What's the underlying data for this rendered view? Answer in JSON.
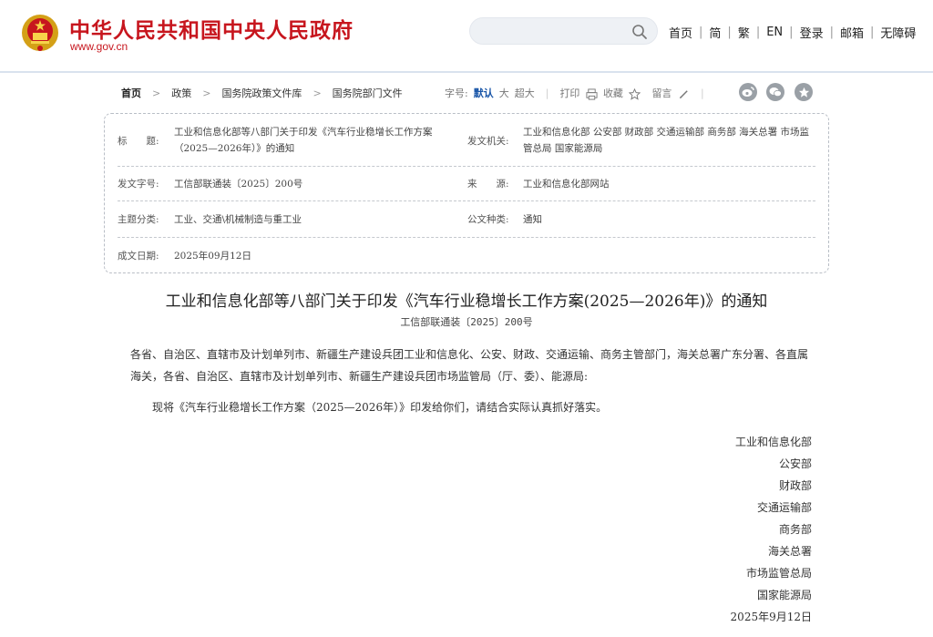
{
  "header": {
    "site_title": "中华人民共和国中央人民政府",
    "site_url": "www.gov.cn",
    "search_placeholder": "",
    "nav": [
      "首页",
      "简",
      "繁",
      "EN",
      "登录",
      "邮箱",
      "无障碍"
    ]
  },
  "breadcrumb": {
    "items": [
      "首页",
      "政策",
      "国务院政策文件库",
      "国务院部门文件"
    ]
  },
  "tools": {
    "font_label": "字号:",
    "font_default": "默认",
    "font_large": "大",
    "font_xlarge": "超大",
    "print": "打印",
    "favorite": "收藏",
    "comment": "留言"
  },
  "meta": {
    "title_label": "标　　题:",
    "title_value": "工业和信息化部等八部门关于印发《汽车行业稳增长工作方案（2025—2026年）》的通知",
    "issuer_label": "发文机关:",
    "issuer_value": "工业和信息化部 公安部 财政部 交通运输部 商务部 海关总署 市场监管总局 国家能源局",
    "doc_no_label": "发文字号:",
    "doc_no_value": "工信部联通装〔2025〕200号",
    "source_label": "来　　源:",
    "source_value": "工业和信息化部网站",
    "topic_label": "主题分类:",
    "topic_value": "工业、交通\\机械制造与重工业",
    "type_label": "公文种类:",
    "type_value": "通知",
    "date_label": "成文日期:",
    "date_value": "2025年09月12日"
  },
  "article": {
    "title": "工业和信息化部等八部门关于印发《汽车行业稳增长工作方案(2025—2026年)》的通知",
    "doc_no": "工信部联通装〔2025〕200号",
    "addressees": "各省、自治区、直辖市及计划单列市、新疆生产建设兵团工业和信息化、公安、财政、交通运输、商务主管部门，海关总署广东分署、各直属海关，各省、自治区、直辖市及计划单列市、新疆生产建设兵团市场监管局（厅、委）、能源局:",
    "body": "现将《汽车行业稳增长工作方案（2025—2026年）》印发给你们，请结合实际认真抓好落实。",
    "signers": [
      "工业和信息化部",
      "公安部",
      "财政部",
      "交通运输部",
      "商务部",
      "海关总署",
      "市场监管总局",
      "国家能源局"
    ],
    "sign_date": "2025年9月12日"
  },
  "colors": {
    "brand_red": "#c7161e",
    "link_blue": "#1a56a8",
    "share_gray": "#9aa0a6"
  },
  "icons": [
    "national-emblem-icon",
    "search-icon",
    "print-icon",
    "star-icon",
    "pencil-icon",
    "weibo-icon",
    "wechat-icon",
    "favorite-star-icon"
  ]
}
